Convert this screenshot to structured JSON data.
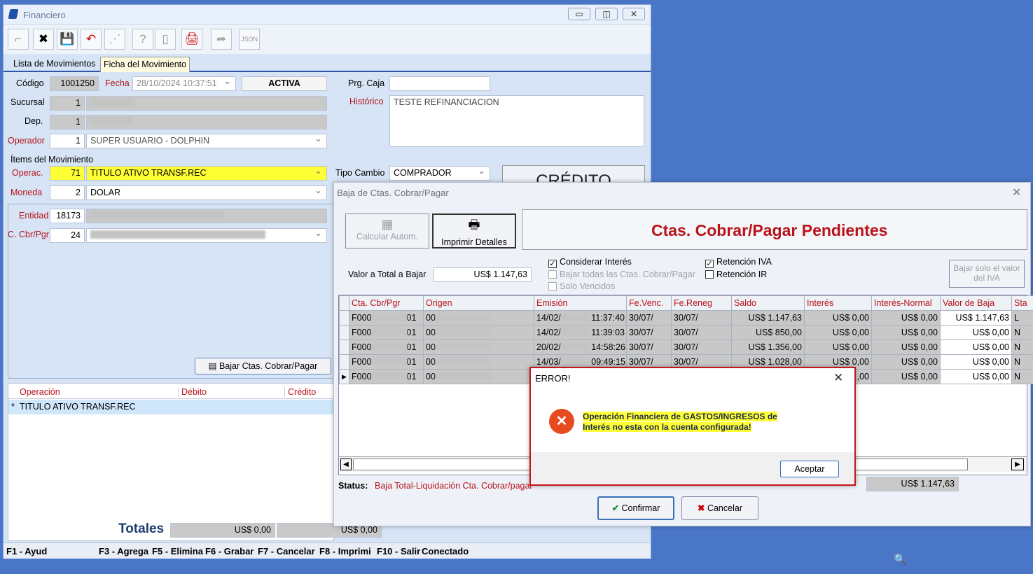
{
  "main": {
    "title": "Financiero",
    "tabs": [
      "Lista de Movimientos",
      "Ficha del Movimiento"
    ],
    "labels": {
      "codigo": "Código",
      "fecha": "Fecha",
      "sucursal": "Sucursal",
      "dep": "Dep.",
      "operador": "Operador",
      "items": "Ítems del Movimiento",
      "operac": "Operac.",
      "moneda": "Moneda",
      "entidad": "Entidad",
      "cbr_pgr": "C. Cbr/Pgr",
      "prg_caja": "Prg. Caja",
      "historico": "Histórico",
      "tipo_cambio": "Tipo Cambio"
    },
    "values": {
      "codigo": "1001250",
      "fecha": "28/10/2024 10:37:51",
      "estado": "ACTIVA",
      "sucursal": "1",
      "dep": "1",
      "operador_id": "1",
      "operador": "SUPER USUARIO - DOLPHIN",
      "operac_id": "71",
      "operac": "TITULO ATIVO TRANSF.REC",
      "moneda_id": "2",
      "moneda": "DOLAR",
      "entidad": "18173",
      "cbr_pgr": "24",
      "historico": "TESTE REFINANCIACION",
      "tipo_cambio": "COMPRADOR",
      "credito": "CRÉDITO"
    },
    "bajar_button": "Bajar Ctas. Cobrar/Pagar",
    "grid_headers": [
      "Operación",
      "Débito",
      "Crédito"
    ],
    "grid_row": "TITULO ATIVO TRANSF.REC",
    "totales": "Totales",
    "total_debito": "US$ 0,00",
    "total_credito": "US$ 0,00",
    "status": [
      "F1 - Ayud",
      "F3 - Agrega",
      "F5 - Elimina",
      "F6 - Grabar",
      "F7 - Cancelar",
      "F8 - Imprimi",
      "F10 - Salir",
      "Conectado"
    ]
  },
  "baja": {
    "title": "Baja de Ctas. Cobrar/Pagar",
    "btn_calcular": "Calcular Autom.",
    "btn_imprimir": "Imprimir Detalles",
    "heading": "Ctas. Cobrar/Pagar Pendientes",
    "valor_label": "Valor a Total a Bajar",
    "valor": "US$ 1.147,63",
    "chk_interes": "Considerar Interés",
    "chk_bajar_todas": "Bajar todas las Ctas. Cobrar/Pagar",
    "chk_vencidos": "Solo Vencidos",
    "chk_ret_iva": "Retención IVA",
    "chk_ret_ir": "Retención IR",
    "btn_iva": "Bajar solo el valor del IVA",
    "columns": [
      "Cta. Cbr/Pgr",
      "Origen",
      "Emisión",
      "Fe.Venc.",
      "Fe.Reneg",
      "Saldo",
      "Interés",
      "Interés-Normal",
      "Valor de Baja",
      "Sta"
    ],
    "rows": [
      {
        "cta": "F000",
        "cta2": "01",
        "origen": "00",
        "emision": "14/02/",
        "hora": "11:37:40",
        "venc": "30/07/",
        "reneg": "30/07/",
        "saldo": "US$ 1.147,63",
        "interes": "US$ 0,00",
        "normal": "US$ 0,00",
        "baja": "US$ 1.147,63",
        "sta": "L"
      },
      {
        "cta": "F000",
        "cta2": "01",
        "origen": "00",
        "emision": "14/02/",
        "hora": "11:39:03",
        "venc": "30/07/",
        "reneg": "30/07/",
        "saldo": "US$ 850,00",
        "interes": "US$ 0,00",
        "normal": "US$ 0,00",
        "baja": "US$ 0,00",
        "sta": "N"
      },
      {
        "cta": "F000",
        "cta2": "01",
        "origen": "00",
        "emision": "20/02/",
        "hora": "14:58:26",
        "venc": "30/07/",
        "reneg": "30/07/",
        "saldo": "US$ 1.356,00",
        "interes": "US$ 0,00",
        "normal": "US$ 0,00",
        "baja": "US$ 0,00",
        "sta": "N"
      },
      {
        "cta": "F000",
        "cta2": "01",
        "origen": "00",
        "emision": "14/03/",
        "hora": "09:49:15",
        "venc": "30/07/",
        "reneg": "30/07/",
        "saldo": "US$ 1.028,00",
        "interes": "US$ 0,00",
        "normal": "US$ 0,00",
        "baja": "US$ 0,00",
        "sta": "N"
      },
      {
        "cta": "F000",
        "cta2": "01",
        "origen": "00",
        "emision": "",
        "hora": "",
        "venc": "",
        "reneg": "",
        "saldo": "",
        "interes": ",00",
        "normal": "US$ 0,00",
        "baja": "US$ 0,00",
        "sta": "N"
      }
    ],
    "status_label": "Status:",
    "status_value": "Baja Total-Liquidación Cta. Cobrar/pagar",
    "total_sel": "US$ 1.147,63",
    "btn_confirmar": "Confirmar",
    "btn_cancelar": "Cancelar"
  },
  "error": {
    "title": "ERROR!",
    "message": "Operación Financiera de GASTOS/INGRESOS de Interés no esta con la cuenta configurada!",
    "btn": "Aceptar"
  },
  "colors": {
    "accent_red": "#b8131b",
    "highlight": "#ffff35",
    "desktop": "#4a76c8"
  }
}
